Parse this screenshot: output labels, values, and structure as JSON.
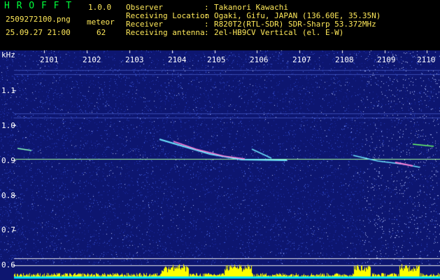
{
  "header": {
    "title": "H R O F F T",
    "version": "1.0.0",
    "filename": "2509272100.png",
    "datetime": "25.09.27 21:00",
    "meteor_label": "meteor",
    "meteor_count": "62",
    "fields": [
      {
        "key": "Observer",
        "value": "Takanori Kawachi"
      },
      {
        "key": "Receiving Location",
        "value": "Ogaki, Gifu, JAPAN (136.60E, 35.35N)"
      },
      {
        "key": "Receiver",
        "value": "R820T2(RTL-SDR) SDR-Sharp 53.372MHz"
      },
      {
        "key": "Receiving antenna",
        "value": "2el-HB9CV Vertical (el. E-W)"
      }
    ],
    "separator": ":"
  },
  "spectrogram": {
    "yunit": "kHz",
    "xticks": [
      "2101",
      "2102",
      "2103",
      "2104",
      "2105",
      "2106",
      "2107",
      "2108",
      "2109",
      "2110"
    ],
    "yticks": [
      "1.1",
      "1.0",
      "0.9",
      "0.8",
      "0.7",
      "0.6"
    ],
    "colors": {
      "background": "#0d1670",
      "carrier": "#a6ff9a",
      "reference_lines": "#e8e8e8",
      "meteor_trail": "#6ee6ff",
      "meteor_head": "#ff7dd8",
      "noise_bars": "#ffff00",
      "baseline": "#00e5ff",
      "ticks": "#ffffff"
    }
  }
}
